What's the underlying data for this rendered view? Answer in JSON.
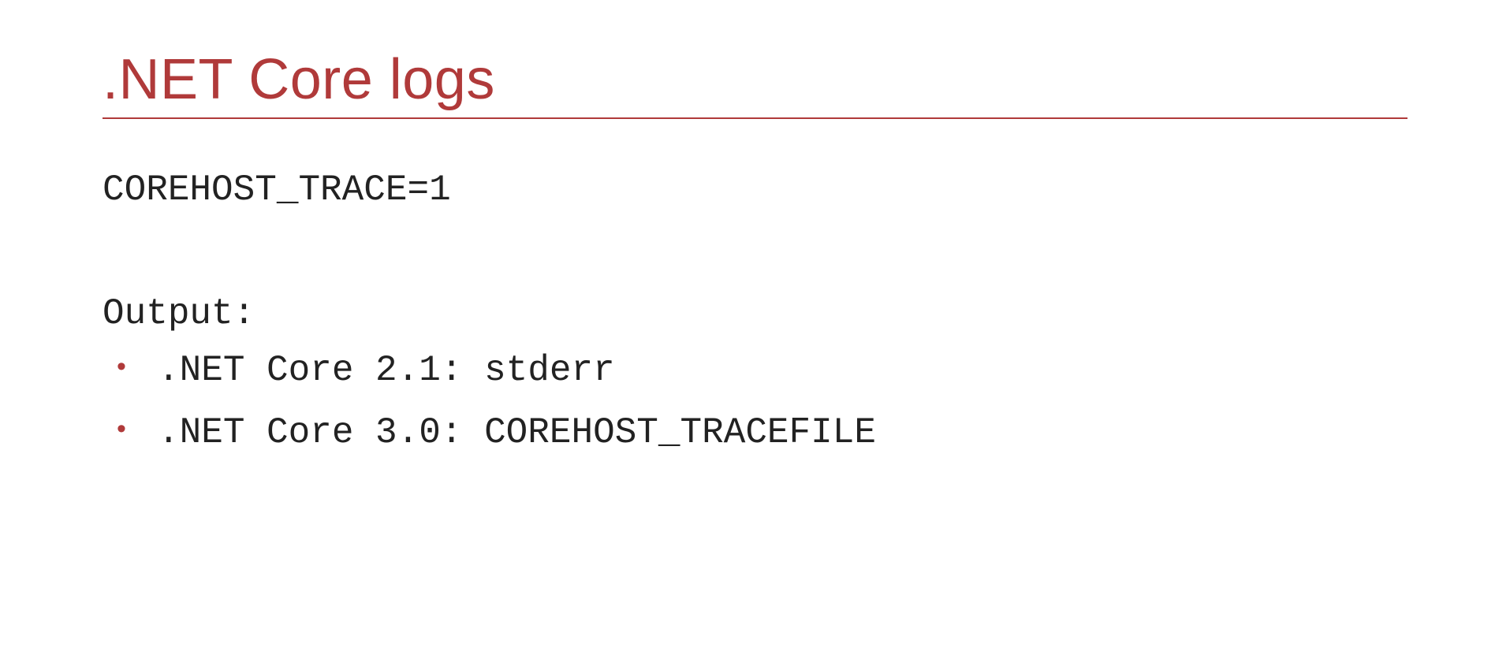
{
  "slide": {
    "title": ".NET Core logs",
    "env_var": "COREHOST_TRACE=1",
    "output_label": "Output:",
    "bullets": [
      ".NET Core 2.1: stderr",
      ".NET Core 3.0: COREHOST_TRACEFILE"
    ]
  }
}
